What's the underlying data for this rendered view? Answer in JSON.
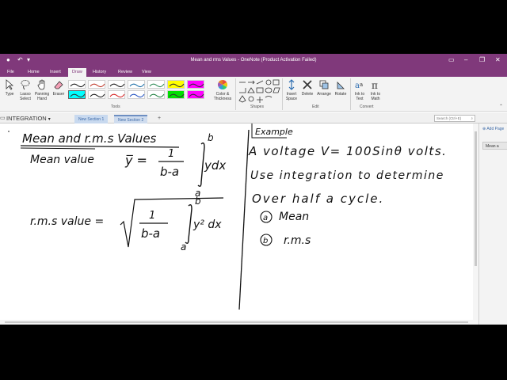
{
  "window": {
    "title": "Mean and rms Values - OneNote (Product Activation Failed)"
  },
  "menu": {
    "tabs": [
      "File",
      "Home",
      "Insert",
      "Draw",
      "History",
      "Review",
      "View"
    ],
    "active": "Draw"
  },
  "ribbon": {
    "type_label": "Type",
    "lasso_label": "Lasso Select",
    "panning_label": "Panning Hand",
    "eraser_label": "Eraser",
    "tools_group": "Tools",
    "color_label": "Color & Thickness",
    "shapes_group": "Shapes",
    "insert_space_label": "Insert Space",
    "delete_label": "Delete",
    "arrange_label": "Arrange",
    "rotate_label": "Rotate",
    "edit_group": "Edit",
    "ink_text_label": "Ink to Text",
    "ink_math_label": "Ink to Math",
    "convert_group": "Convert",
    "pen_colors": [
      "#1a1a1a",
      "#c0392b",
      "#1a1a1a",
      "#1a6ea8",
      "#2e8b57",
      "#ffff00",
      "#ff00ff",
      "#00ffff",
      "#1a1a1a",
      "#d62020",
      "#2050c0",
      "#208040",
      "#00e000",
      "#ff00ff",
      "#1a1a1a"
    ]
  },
  "sections": {
    "notebook": "INTEGRATION",
    "tabs": [
      "New Section 1",
      "New Section 2"
    ],
    "add_tab": "+",
    "search_placeholder": "Search (Ctrl+E)"
  },
  "pages": {
    "add_page": "Add Page",
    "items": [
      "Mean a"
    ]
  },
  "ink": {
    "title": "Mean and r.m.s Values",
    "mean_label": "Mean value",
    "mean_var": "y̅ =",
    "frac_num": "1",
    "frac_den": "b-a",
    "upper": "b",
    "lower": "a",
    "mean_integrand": "ydx",
    "rms_label": "r.m.s value =",
    "rms_integrand": "y² dx",
    "example": "Example",
    "line1": "A voltage  V= 100Sinθ  volts.",
    "line2": "Use integration to determine",
    "line3": "Over half a cycle.",
    "opt_a_mark": "a",
    "opt_a": "Mean",
    "opt_b_mark": "b",
    "opt_b": "r.m.s"
  }
}
